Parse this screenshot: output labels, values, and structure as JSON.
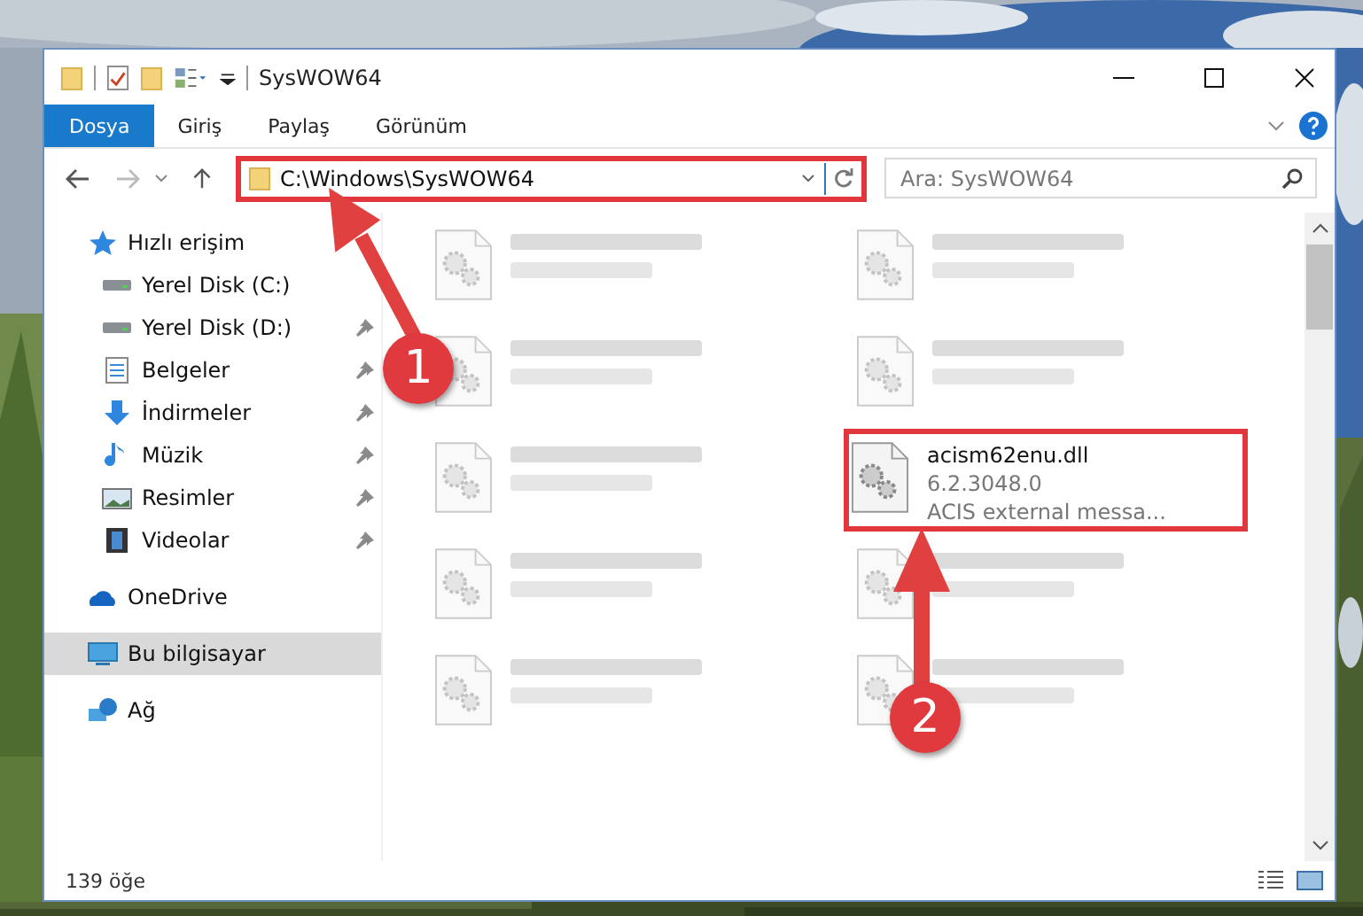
{
  "window": {
    "title": "SysWOW64"
  },
  "ribbon": {
    "tabs": [
      {
        "label": "Dosya",
        "selected": true
      },
      {
        "label": "Giriş",
        "selected": false
      },
      {
        "label": "Paylaş",
        "selected": false
      },
      {
        "label": "Görünüm",
        "selected": false
      }
    ]
  },
  "address_bar": {
    "path": "C:\\Windows\\SysWOW64",
    "highlighted": true
  },
  "search": {
    "placeholder": "Ara: SysWOW64"
  },
  "sidebar": {
    "items": [
      {
        "label": "Hızlı erişim",
        "kind": "star",
        "selected": false,
        "children": [
          {
            "label": "Yerel Disk (C:)",
            "kind": "drive",
            "pinned": false,
            "selected": false
          },
          {
            "label": "Yerel Disk (D:)",
            "kind": "drive",
            "pinned": true,
            "selected": false
          },
          {
            "label": "Belgeler",
            "kind": "doc",
            "pinned": true,
            "selected": false
          },
          {
            "label": "İndirmeler",
            "kind": "download",
            "pinned": true,
            "selected": false
          },
          {
            "label": "Müzik",
            "kind": "music",
            "pinned": true,
            "selected": false
          },
          {
            "label": "Resimler",
            "kind": "pictures",
            "pinned": true,
            "selected": false
          },
          {
            "label": "Videolar",
            "kind": "video",
            "pinned": true,
            "selected": false
          }
        ]
      },
      {
        "label": "OneDrive",
        "kind": "cloud",
        "selected": false
      },
      {
        "label": "Bu bilgisayar",
        "kind": "pc",
        "selected": true
      },
      {
        "label": "Ağ",
        "kind": "network",
        "selected": false
      }
    ]
  },
  "files": [
    {
      "blurred": true,
      "highlighted": false
    },
    {
      "blurred": true,
      "highlighted": false
    },
    {
      "blurred": true,
      "highlighted": false
    },
    {
      "blurred": true,
      "highlighted": false
    },
    {
      "blurred": true,
      "highlighted": false
    },
    {
      "name": "acism62enu.dll",
      "version": "6.2.3048.0",
      "description": "ACIS external messa...",
      "blurred": false,
      "highlighted": true
    },
    {
      "blurred": true,
      "highlighted": false
    },
    {
      "blurred": true,
      "highlighted": false
    },
    {
      "blurred": true,
      "highlighted": false
    },
    {
      "blurred": true,
      "highlighted": false
    }
  ],
  "status_bar": {
    "count": "139 öğe"
  },
  "callouts": [
    {
      "label": "1"
    },
    {
      "label": "2"
    }
  ]
}
